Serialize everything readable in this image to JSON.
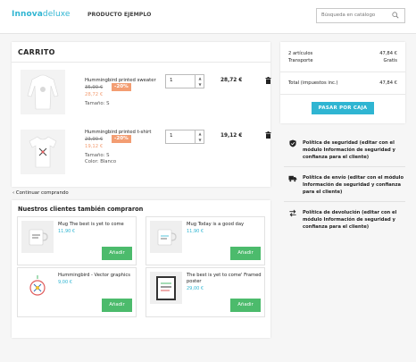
{
  "header": {
    "logo_main": "Innova",
    "logo_sub": "deluxe",
    "nav_link": "PRODUCTO EJEMPLO",
    "search_placeholder": "Búsqueda en catálogo"
  },
  "cart": {
    "title": "CARRITO",
    "items": [
      {
        "name": "Hummingbird printed sweater",
        "old_price": "35,90 €",
        "discount": "-20%",
        "new_price": "28,72 €",
        "attr1": "Tamaño: S",
        "attr2": "",
        "qty": "1",
        "total": "28,72 €"
      },
      {
        "name": "Hummingbird printed t-shirt",
        "old_price": "23,90 €",
        "discount": "-20%",
        "new_price": "19,12 €",
        "attr1": "Tamaño: S",
        "attr2": "Color: Blanco",
        "qty": "1",
        "total": "19,12 €"
      }
    ]
  },
  "continue_shopping": "Continuar comprando",
  "also_bought": {
    "title": "Nuestros clientes también compraron",
    "add_label": "Añadir",
    "products": [
      {
        "name": "Mug The best is yet to come",
        "price": "11,90 €"
      },
      {
        "name": "Mug Today is a good day",
        "price": "11,90 €"
      },
      {
        "name": "Hummingbird - Vector graphics",
        "price": "9,00 €"
      },
      {
        "name": "The best is yet to come' Framed poster",
        "price": "29,00 €"
      }
    ]
  },
  "summary": {
    "articles_label": "2 artículos",
    "articles_value": "47,84 €",
    "shipping_label": "Transporte",
    "shipping_value": "Gratis",
    "total_label": "Total (impuestos inc.)",
    "total_value": "47,84 €",
    "checkout_label": "PASAR POR CAJA"
  },
  "reassurance": [
    {
      "icon": "shield-check-icon",
      "text": "Política de seguridad (editar con el módulo Información de seguridad y confianza para el cliente)"
    },
    {
      "icon": "truck-icon",
      "text": "Política de envío (editar con el módulo Información de seguridad y confianza para el cliente)"
    },
    {
      "icon": "swap-arrows-icon",
      "text": "Política de devolución (editar con el módulo Información de seguridad y confianza para el cliente)"
    }
  ],
  "colors": {
    "accent": "#2fb5d2",
    "discount": "#f39d72",
    "add_button": "#4cbb6c"
  }
}
